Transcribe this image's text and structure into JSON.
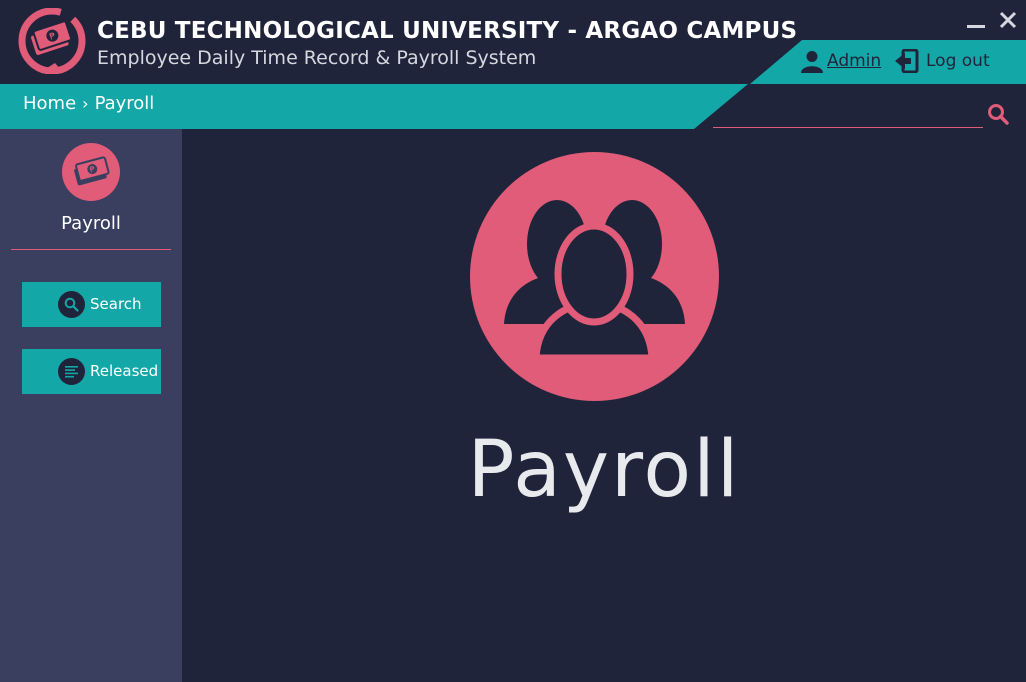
{
  "header": {
    "title": "CEBU TECHNOLOGICAL UNIVERSITY - ARGAO CAMPUS",
    "subtitle": "Employee Daily Time Record & Payroll System",
    "user_label": "Admin",
    "logout_label": "Log out"
  },
  "breadcrumb": {
    "home": "Home",
    "separator": "›",
    "current": "Payroll"
  },
  "search": {
    "value": "",
    "placeholder": ""
  },
  "sidebar": {
    "title": "Payroll",
    "buttons": [
      {
        "label": "Search",
        "icon": "search-icon"
      },
      {
        "label": "Released",
        "icon": "list-icon"
      }
    ]
  },
  "main": {
    "title": "Payroll",
    "icon": "users-icon"
  },
  "colors": {
    "background": "#20243a",
    "sidebar": "#3a3f60",
    "accent_teal": "#14a7a8",
    "accent_pink": "#e05c78"
  }
}
